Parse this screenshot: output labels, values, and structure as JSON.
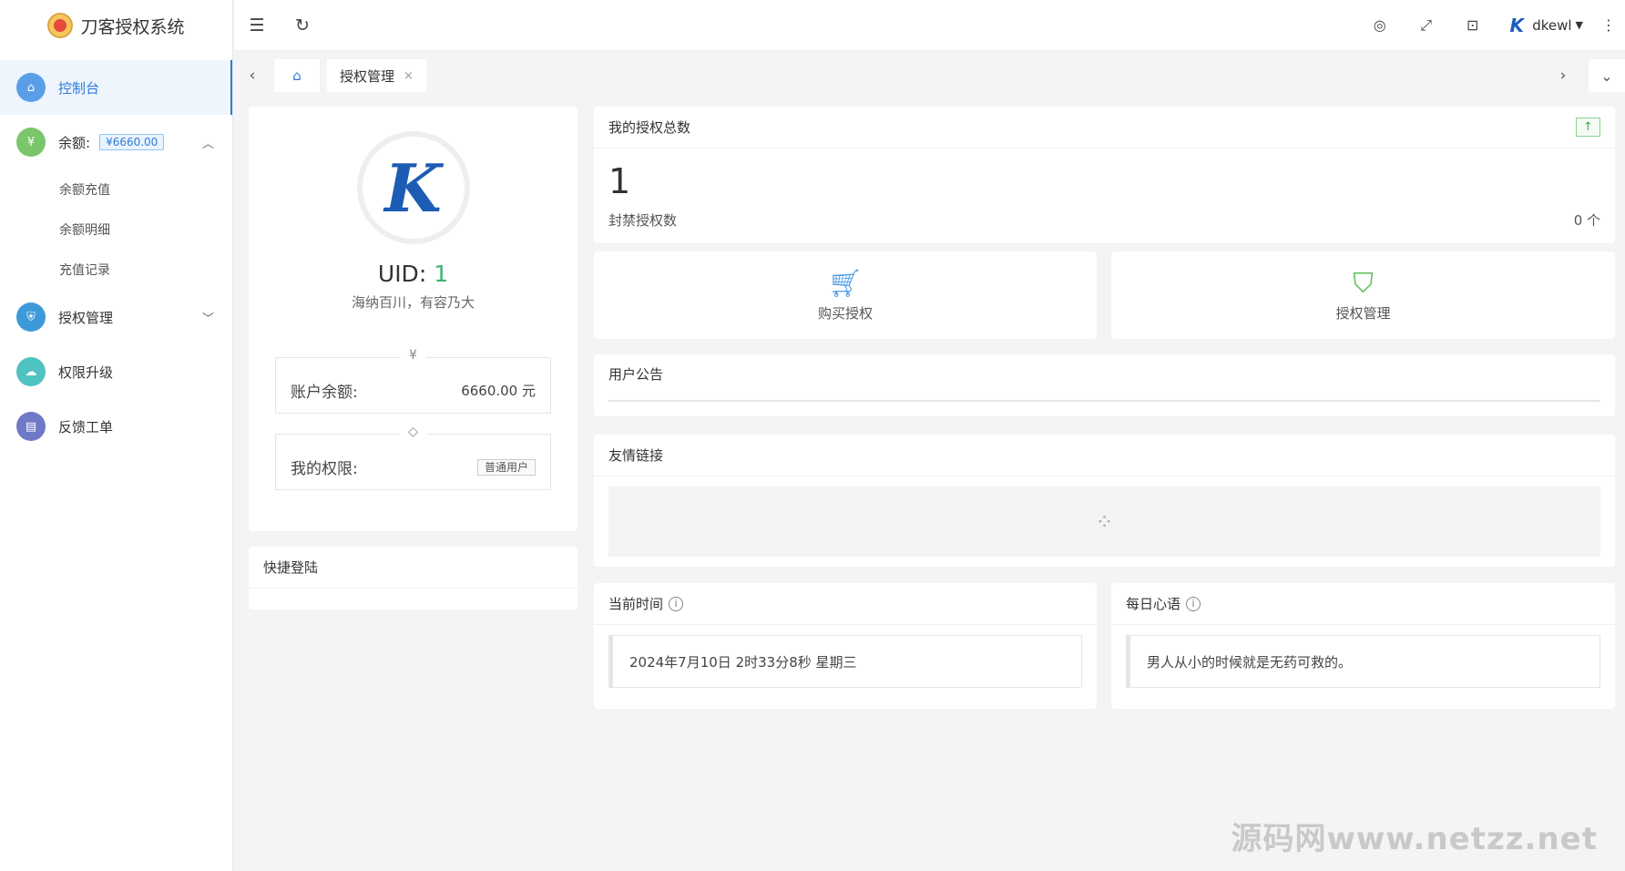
{
  "app": {
    "title": "刀客授权系统"
  },
  "sidebar": {
    "items": [
      {
        "label": "控制台",
        "color": "#5b9ee8"
      },
      {
        "label": "余额:",
        "badge": "¥6660.00",
        "color": "#7ac66a",
        "chevron": "chevron-up-icon"
      },
      {
        "label": "授权管理",
        "color": "#3d9ad9",
        "chevron": "chevron-down-icon"
      },
      {
        "label": "权限升级",
        "color": "#4fc2c2"
      },
      {
        "label": "反馈工单",
        "color": "#6e79c7"
      }
    ],
    "balance_sub": [
      "余额充值",
      "余额明细",
      "充值记录"
    ]
  },
  "topbar": {
    "username": "dkewl"
  },
  "tabs": {
    "items": [
      {
        "label": "授权管理",
        "close": "×"
      }
    ]
  },
  "profile": {
    "uid_label": "UID: ",
    "uid": "1",
    "motto": "海纳百川，有容乃大",
    "balance_icon": "¥",
    "balance_label": "账户余额:",
    "balance_value": "6660.00 元",
    "level_label": "我的权限:",
    "level_value": "普通用户"
  },
  "quick_login": {
    "title": "快捷登陆"
  },
  "auth_total": {
    "title": "我的授权总数",
    "count": "1",
    "banned_label": "封禁授权数",
    "banned_value": "0 个"
  },
  "actions": [
    {
      "label": "购买授权",
      "icon": "cart-icon",
      "color": "#4f9ee6"
    },
    {
      "label": "授权管理",
      "icon": "shield-check-icon",
      "color": "#5bbf5e"
    }
  ],
  "notice": {
    "title": "用户公告"
  },
  "links": {
    "title": "友情链接"
  },
  "time": {
    "title": "当前时间",
    "value": "2024年7月10日 2时33分8秒 星期三"
  },
  "quote": {
    "title": "每日心语",
    "value": "男人从小的时候就是无药可救的。"
  },
  "watermark": "源码网www.netzz.net"
}
